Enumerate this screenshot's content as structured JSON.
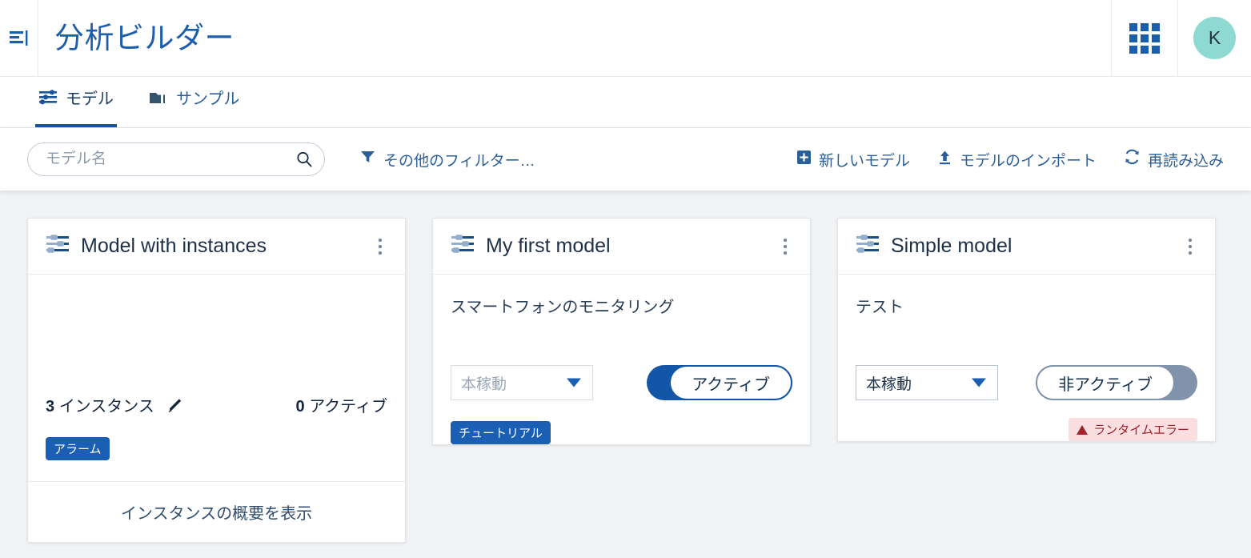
{
  "header": {
    "menu_icon": "menu-collapse-icon",
    "title": "分析ビルダー",
    "app_launcher_icon": "grid-apps-icon",
    "avatar_initial": "K",
    "avatar_color": "#8ed9d2",
    "title_color": "#1b5fac"
  },
  "tabs": [
    {
      "label": "モデル",
      "icon": "tune-sliders-icon",
      "active": true
    },
    {
      "label": "サンプル",
      "icon": "folder-icon",
      "active": false
    }
  ],
  "toolbar": {
    "search": {
      "placeholder": "モデル名",
      "value": "",
      "icon": "search-icon"
    },
    "filters": {
      "label": "その他のフィルター…",
      "icon": "filter-funnel-icon"
    },
    "actions": [
      {
        "label": "新しいモデル",
        "icon": "plus-square-icon"
      },
      {
        "label": "モデルのインポート",
        "icon": "upload-icon"
      },
      {
        "label": "再読み込み",
        "icon": "refresh-icon"
      }
    ]
  },
  "cards": [
    {
      "title": "Model with instances",
      "icon": "model-sliders-icon",
      "menu_icon": "kebab-menu-icon",
      "description": "",
      "instances_count": "3",
      "instances_label": "インスタンス",
      "edit_icon": "pencil-icon",
      "active_count": "0",
      "active_label": "アクティブ",
      "badge": "アラーム",
      "badge_color": "#1a5fb4",
      "footer_link": "インスタンスの概要を表示"
    },
    {
      "title": "My first model",
      "icon": "model-sliders-icon",
      "menu_icon": "kebab-menu-icon",
      "description": "スマートフォンのモニタリング",
      "select_value": "本稼動",
      "toggle_state": "on",
      "toggle_label": "アクティブ",
      "badge": "チュートリアル",
      "badge_color": "#1a5fb4"
    },
    {
      "title": "Simple model",
      "icon": "model-sliders-icon",
      "menu_icon": "kebab-menu-icon",
      "description": "テスト",
      "select_value": "本稼動",
      "toggle_state": "off",
      "toggle_label": "非アクティブ",
      "error_badge": "ランタイムエラー",
      "error_color": "#a3212a",
      "error_bg": "#fadee0"
    }
  ]
}
